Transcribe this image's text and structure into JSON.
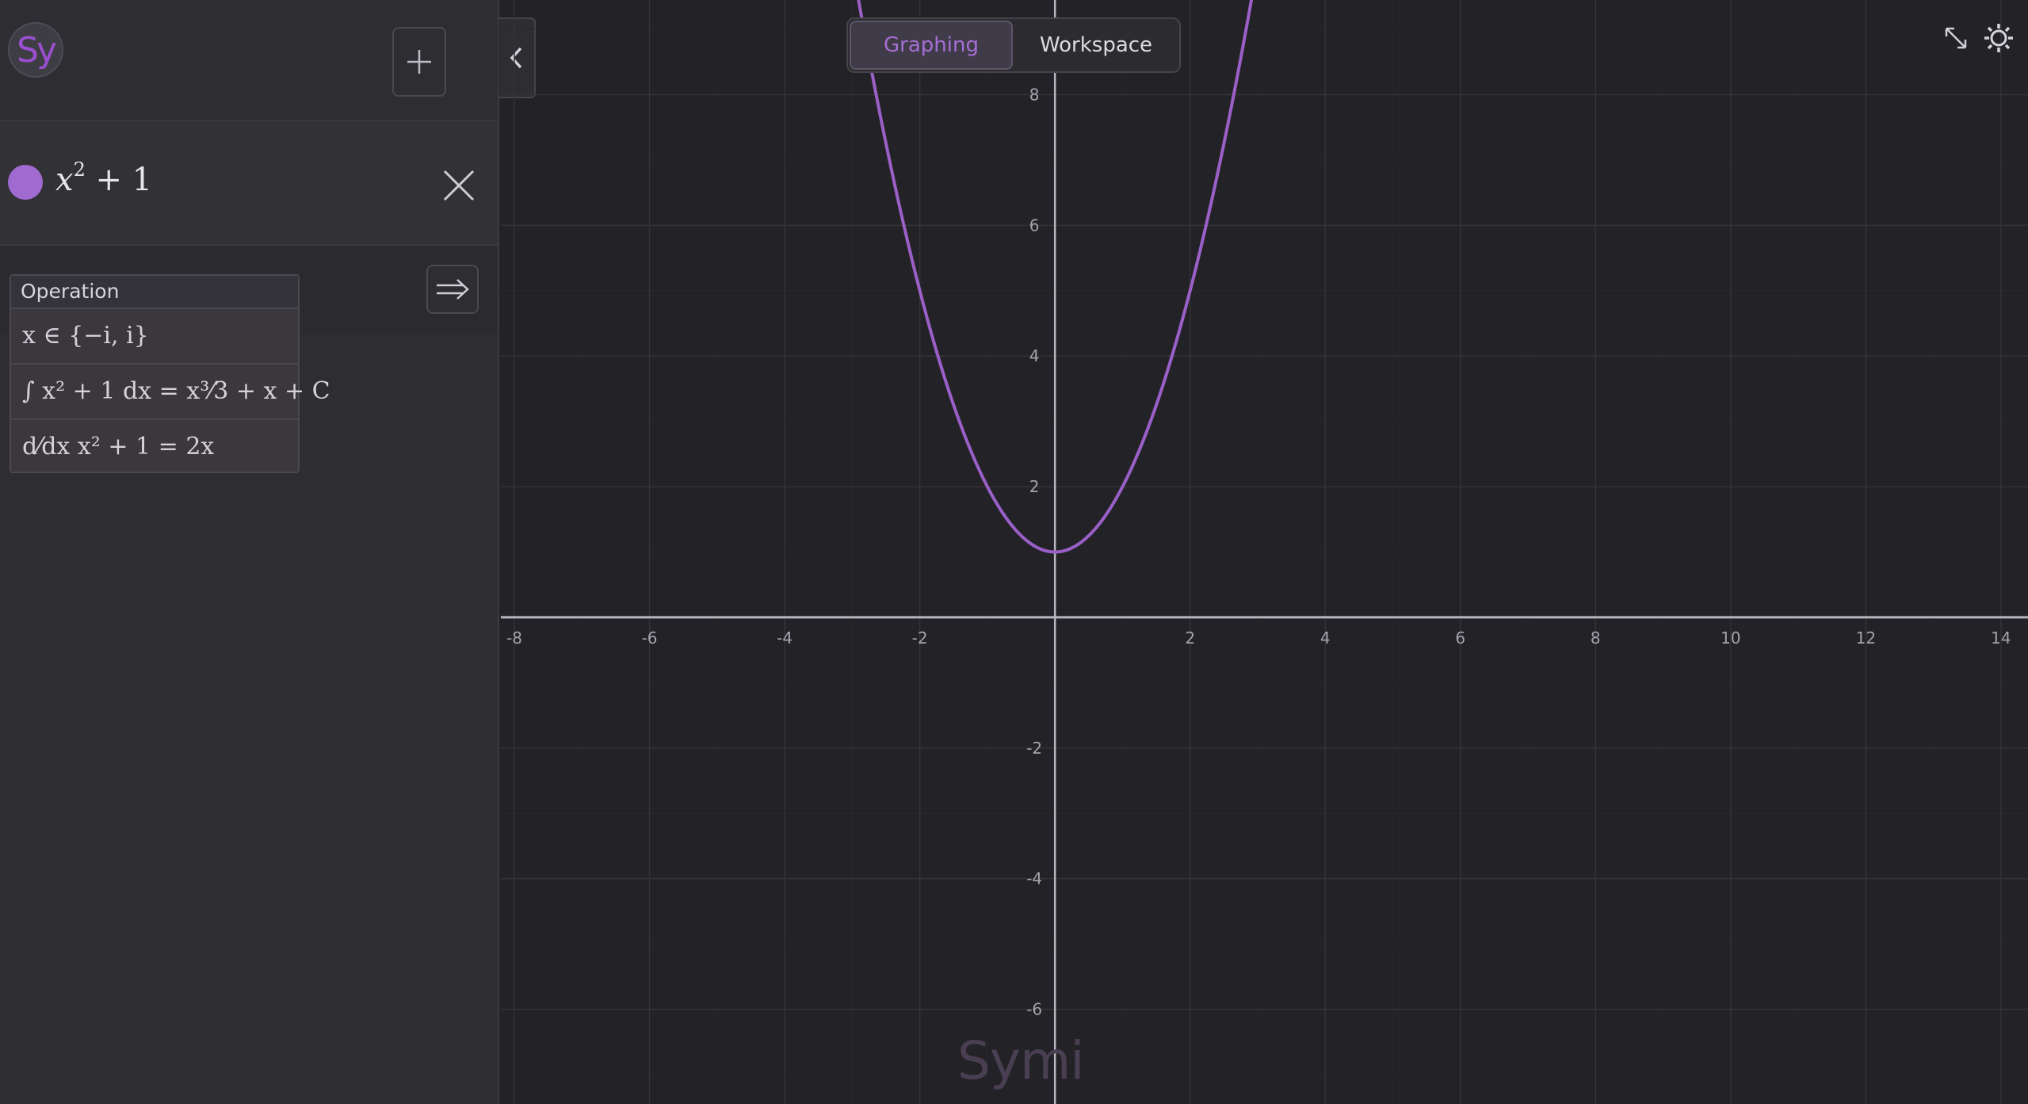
{
  "app": {
    "logo_text": "Sy",
    "watermark": "Symi"
  },
  "sidebar": {
    "add_button_icon": "plus-icon",
    "collapse_icon": "chevron-left-icon",
    "expression": {
      "base": "x",
      "exponent": "2",
      "rest": " + 1",
      "color": "#a16ad0",
      "remove_icon": "close-icon"
    },
    "operation_menu": {
      "header": "Operation",
      "items": [
        "x ∈ {−i, i}",
        "∫ x² + 1 dx = x³⁄3 + x + C",
        "d⁄dx x² + 1 = 2x"
      ]
    },
    "apply_icon": "double-arrow-right-icon"
  },
  "toolbar": {
    "tabs": [
      "Graphing",
      "Workspace"
    ],
    "active_tab": "Graphing",
    "fullscreen_icon": "expand-icon",
    "settings_icon": "gear-icon"
  },
  "colors": {
    "accent": "#a66fd6",
    "curve": "#9a60c8",
    "background": "#232226",
    "sidebar": "#2e2d31"
  },
  "chart_data": {
    "type": "line",
    "function": "x^2 + 1",
    "x_ticks": [
      -8,
      -6,
      -4,
      -2,
      2,
      4,
      6,
      8,
      10,
      12,
      14
    ],
    "y_ticks": [
      -6,
      -4,
      -2,
      2,
      4,
      6,
      8
    ],
    "xlim": [
      -8.2,
      14.4
    ],
    "ylim": [
      -7.45,
      9.45
    ],
    "grid": true,
    "minor_grid": true,
    "series": [
      {
        "expr": "x^2+1",
        "color": "#9a60c8"
      }
    ]
  }
}
